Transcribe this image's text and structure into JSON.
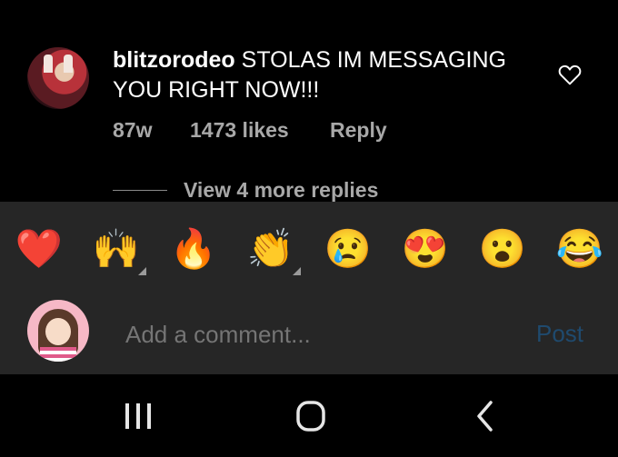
{
  "comment": {
    "username": "blitzorodeo",
    "text": "STOLAS IM MESSAGING YOU RIGHT NOW!!!",
    "age": "87w",
    "likes": "1473 likes",
    "reply_label": "Reply",
    "view_replies": "View 4 more replies"
  },
  "reactions": [
    {
      "emoji": "❤️",
      "name": "red-heart"
    },
    {
      "emoji": "🙌",
      "name": "raising-hands"
    },
    {
      "emoji": "🔥",
      "name": "fire"
    },
    {
      "emoji": "👏",
      "name": "clapping-hands"
    },
    {
      "emoji": "😢",
      "name": "crying-face"
    },
    {
      "emoji": "😍",
      "name": "heart-eyes"
    },
    {
      "emoji": "😮",
      "name": "surprised-face"
    },
    {
      "emoji": "😂",
      "name": "tears-of-joy"
    }
  ],
  "composer": {
    "placeholder": "Add a comment...",
    "post_label": "Post"
  },
  "colors": {
    "background": "#000000",
    "panel": "#262626",
    "secondary_text": "#a8a8a8",
    "post_disabled": "#1f4a6e"
  },
  "icons": {
    "like": "heart-outline-icon",
    "nav_recents": "recent-apps-icon",
    "nav_home": "home-icon",
    "nav_back": "back-icon"
  }
}
